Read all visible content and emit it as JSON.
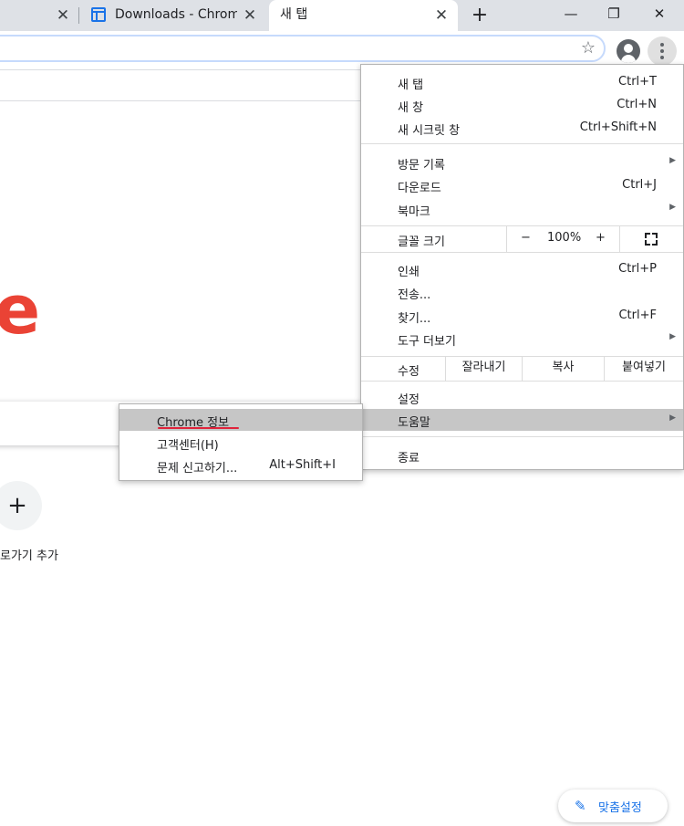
{
  "tabs": [
    {
      "title": "Downloads - ChromeDrive",
      "icon": "document-icon"
    },
    {
      "title": "새 탭"
    }
  ],
  "window_controls": {
    "minimize": "—",
    "maximize": "❐",
    "close": "✕"
  },
  "page": {
    "logo_fragment": "e",
    "shortcut_label": "로가기 추가",
    "customize_label": "맞춤설정"
  },
  "menu": {
    "new_tab": {
      "label": "새 탭",
      "shortcut": "Ctrl+T"
    },
    "new_window": {
      "label": "새 창",
      "shortcut": "Ctrl+N"
    },
    "incognito": {
      "label": "새 시크릿 창",
      "shortcut": "Ctrl+Shift+N"
    },
    "history": {
      "label": "방문 기록"
    },
    "downloads": {
      "label": "다운로드",
      "shortcut": "Ctrl+J"
    },
    "bookmarks": {
      "label": "북마크"
    },
    "zoom": {
      "label": "글꼴 크기",
      "minus": "−",
      "value": "100%",
      "plus": "+"
    },
    "print": {
      "label": "인쇄",
      "shortcut": "Ctrl+P"
    },
    "cast": {
      "label": "전송..."
    },
    "find": {
      "label": "찾기...",
      "shortcut": "Ctrl+F"
    },
    "more_tools": {
      "label": "도구 더보기"
    },
    "edit": {
      "label": "수정",
      "cut": "잘라내기",
      "copy": "복사",
      "paste": "붙여넣기"
    },
    "settings": {
      "label": "설정"
    },
    "help": {
      "label": "도움말"
    },
    "exit": {
      "label": "종료"
    }
  },
  "help_submenu": {
    "about": {
      "label": "Chrome 정보"
    },
    "help_center": {
      "label": "고객센터(H)"
    },
    "report": {
      "label": "문제 신고하기...",
      "shortcut": "Alt+Shift+I"
    }
  },
  "colors": {
    "highlight": "#c6c6c6",
    "annotation_underline": "#e0233b",
    "accent": "#1a73e8"
  }
}
